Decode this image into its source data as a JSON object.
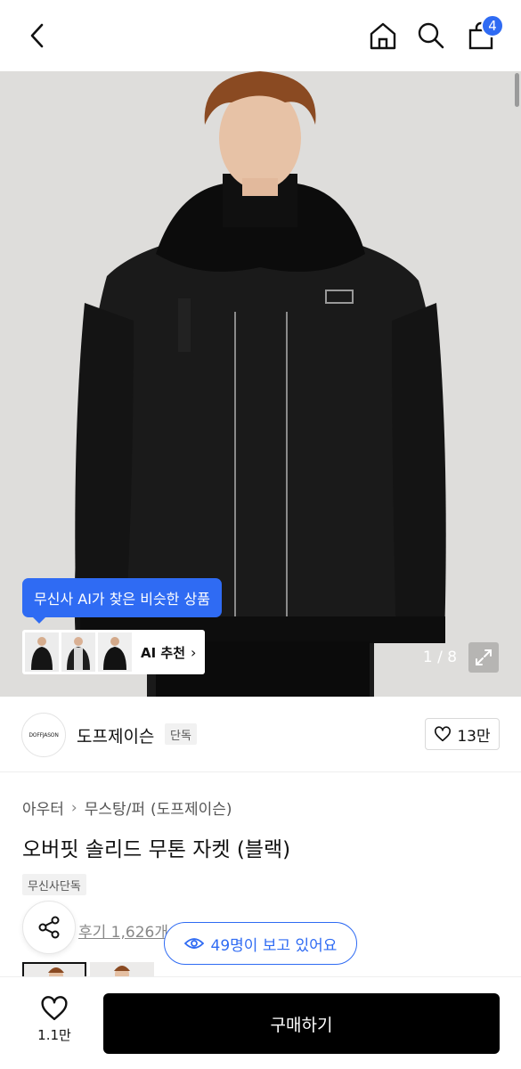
{
  "header": {
    "back_icon": "chevron-left-icon",
    "home_icon": "home-icon",
    "search_icon": "search-icon",
    "cart_icon": "shopping-bag-icon",
    "cart_count": "4"
  },
  "gallery": {
    "ai_bubble_text": "무신사 AI가 찾은 비슷한 상품",
    "ai_recommend_label": "AI 추천",
    "pager": "1 / 8",
    "expand_icon": "expand-icon"
  },
  "brand": {
    "logo_text": "DOFFJASON",
    "name": "도프제이슨",
    "tag": "단독",
    "likes": "13만"
  },
  "product": {
    "breadcrumb": [
      "아우터",
      "무스탕/퍼",
      "(도프제이슨)"
    ],
    "title": "오버핏 솔리드 무톤 자켓 (블랙)",
    "exclusive_tag": "무신사단독",
    "reviews": "후기 1,626개",
    "viewing": "49명이 보고 있어요"
  },
  "bottom_bar": {
    "wish_count": "1.1만",
    "buy_label": "구매하기"
  },
  "colors": {
    "accent": "#2f6bf3",
    "buy_button": "#000000"
  }
}
